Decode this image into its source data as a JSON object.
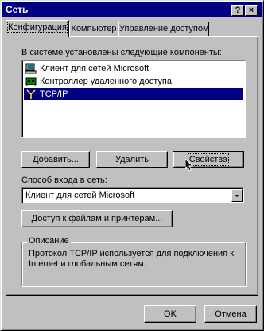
{
  "window": {
    "title": "Сеть",
    "help_button": "?",
    "close_button": "×"
  },
  "tabs": [
    {
      "label": "Конфигурация"
    },
    {
      "label": "Компьютер"
    },
    {
      "label": "Управление доступом"
    }
  ],
  "components": {
    "label": "В системе установлены следующие компоненты:",
    "items": [
      {
        "label": "Клиент для сетей Microsoft",
        "icon": "network-client-icon"
      },
      {
        "label": "Контроллер удаленного доступа",
        "icon": "network-adapter-icon"
      },
      {
        "label": "TCP/IP",
        "icon": "protocol-icon",
        "selected": true
      }
    ]
  },
  "buttons": {
    "add": "Добавить...",
    "remove": "Удалить",
    "properties": "Свойства",
    "file_printer_sharing": "Доступ к файлам и принтерам...",
    "ok": "OK",
    "cancel": "Отмена"
  },
  "logon": {
    "label": "Способ входа в сеть:",
    "selected": "Клиент для сетей Microsoft"
  },
  "description": {
    "legend": "Описание",
    "text": "Протокол TCP/IP используется для подключения к\nInternet и глобальным сетям."
  },
  "colors": {
    "face": "#c0c0c0",
    "title_bar": "#000080",
    "selection": "#000080"
  }
}
